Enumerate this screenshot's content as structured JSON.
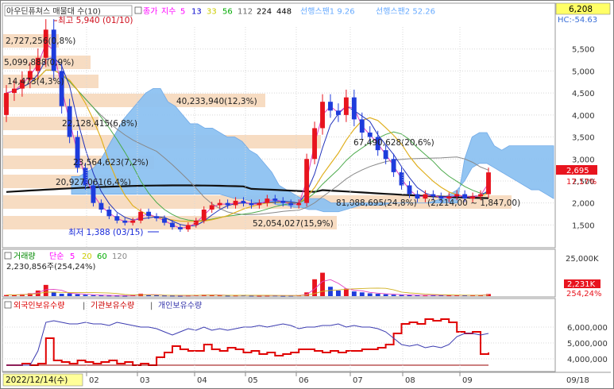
{
  "price_panel": {
    "title_stock": "아우딘퓨쳐스 매물대 수(10)",
    "legend": [
      {
        "text": "종가",
        "color": "#ff00ff"
      },
      {
        "text": "지수",
        "color": "#ff00ff"
      },
      {
        "text": "5",
        "color": "#ff00ff"
      },
      {
        "text": "13",
        "color": "#0000cc"
      },
      {
        "text": "33",
        "color": "#cccc00"
      },
      {
        "text": "56",
        "color": "#00aa00"
      },
      {
        "text": "112",
        "color": "#666666"
      },
      {
        "text": "224",
        "color": "#000000"
      },
      {
        "text": "448",
        "color": "#000000"
      },
      {
        "text": "선행스팬1 9.26",
        "color": "#66aaff"
      },
      {
        "text": "선행스팬2 52.26",
        "color": "#66aaff"
      }
    ],
    "hc_label": "HC:-54.63",
    "current_price_badge": "6,208",
    "y_ticks": [
      "5,500",
      "5,000",
      "4,500",
      "4,000",
      "3,500",
      "3,000",
      "2,500",
      "2,000",
      "1,500"
    ],
    "last_price": "2,695",
    "last_change": "17.17%",
    "high_annotation": "최고 5,940 (01/10)",
    "low_annotation": "최저 1,388 (03/15)",
    "volume_profile_labels": [
      "2,727,256(0,8%)",
      "5,099,888(0,9%)",
      "14,473(4,3%)",
      "40,233,940(12,3%)",
      "22,128,415(6,8%)",
      "67,490,628(20,6%)",
      "23,564,623(7,2%)",
      "20,927,061(6,4%)",
      "81,088,695(24,8%)",
      "52,054,027(15,9%)"
    ],
    "recent_label": "(2,214,00 ~ 1,847,00)"
  },
  "volume_panel": {
    "legend": [
      {
        "text": "거래량",
        "color": "#008800"
      },
      {
        "text": "단순",
        "color": "#ff00ff"
      },
      {
        "text": "5",
        "color": "#ff00ff"
      },
      {
        "text": "20",
        "color": "#cccc00"
      },
      {
        "text": "60",
        "color": "#00aa00"
      },
      {
        "text": "120",
        "color": "#888888"
      }
    ],
    "summary": "2,230,856주(254,24%)",
    "y_tick": "25,000K",
    "last_volume": "2,231K",
    "last_volume_pct": "254,24%"
  },
  "holdings_panel": {
    "legend": [
      {
        "text": "외국인보유수량",
        "color": "#dd0000"
      },
      {
        "text": "기관보유수량",
        "color": "#cc0000"
      },
      {
        "text": "개인보유수량",
        "color": "#3333aa"
      }
    ],
    "y_ticks": [
      "6,000,000",
      "5,000,000",
      "4,000,000"
    ]
  },
  "x_axis": {
    "start_date": "2022/12/14(수)",
    "months": [
      "02",
      "03",
      "04",
      "05",
      "06",
      "07",
      "08",
      "09"
    ],
    "end_date": "09/18"
  },
  "colors": {
    "up": "#e8141e",
    "down": "#1e3cdc",
    "cloud": "#7fbaf0",
    "profile": "#f7dcc2"
  },
  "chart_data": {
    "type": "candlestick",
    "price_series": [
      [
        4.0,
        4.5
      ],
      [
        4.5,
        4.6
      ],
      [
        4.6,
        4.8
      ],
      [
        4.8,
        5.0
      ],
      [
        5.0,
        5.3
      ],
      [
        5.3,
        5.94
      ],
      [
        5.94,
        5.0
      ],
      [
        5.0,
        4.2
      ],
      [
        4.2,
        3.5
      ],
      [
        3.5,
        2.8
      ],
      [
        2.8,
        2.4
      ],
      [
        2.4,
        2.0
      ],
      [
        2.0,
        1.85
      ],
      [
        1.85,
        1.7
      ],
      [
        1.7,
        1.6
      ],
      [
        1.6,
        1.55
      ],
      [
        1.55,
        1.6
      ],
      [
        1.6,
        1.8
      ],
      [
        1.8,
        1.7
      ],
      [
        1.7,
        1.65
      ],
      [
        1.65,
        1.55
      ],
      [
        1.55,
        1.45
      ],
      [
        1.45,
        1.4
      ],
      [
        1.4,
        1.5
      ],
      [
        1.5,
        1.6
      ],
      [
        1.6,
        1.85
      ],
      [
        1.85,
        1.95
      ],
      [
        1.95,
        2.0
      ],
      [
        2.0,
        1.95
      ],
      [
        1.95,
        2.05
      ],
      [
        2.05,
        2.0
      ],
      [
        2.0,
        1.95
      ],
      [
        1.95,
        2.0
      ],
      [
        2.0,
        2.1
      ],
      [
        2.1,
        2.05
      ],
      [
        2.05,
        2.0
      ],
      [
        2.0,
        1.95
      ],
      [
        1.95,
        2.0
      ],
      [
        2.0,
        3.0
      ],
      [
        3.0,
        3.7
      ],
      [
        3.7,
        4.3
      ],
      [
        4.3,
        4.1
      ],
      [
        4.1,
        4.0
      ],
      [
        4.0,
        4.4
      ],
      [
        4.4,
        3.9
      ],
      [
        3.9,
        3.6
      ],
      [
        3.6,
        3.5
      ],
      [
        3.5,
        3.2
      ],
      [
        3.2,
        3.0
      ],
      [
        3.0,
        2.7
      ],
      [
        2.7,
        2.4
      ],
      [
        2.4,
        2.2
      ],
      [
        2.2,
        2.1
      ],
      [
        2.1,
        2.2
      ],
      [
        2.2,
        2.15
      ],
      [
        2.15,
        2.1
      ],
      [
        2.1,
        2.15
      ],
      [
        2.15,
        2.2
      ],
      [
        2.2,
        2.1
      ],
      [
        2.1,
        2.15
      ],
      [
        2.15,
        2.2
      ],
      [
        2.2,
        2.695
      ]
    ],
    "volume_series": [
      1.2,
      1.5,
      2.0,
      3.0,
      6.0,
      12.0,
      4.0,
      2.5,
      3.0,
      2.0,
      1.5,
      1.0,
      0.8,
      0.7,
      0.6,
      0.5,
      1.0,
      2.5,
      1.2,
      0.9,
      0.7,
      0.6,
      0.5,
      0.7,
      0.9,
      1.5,
      1.2,
      0.8,
      0.6,
      0.7,
      0.8,
      0.6,
      0.5,
      0.6,
      0.7,
      0.5,
      0.6,
      0.8,
      4.0,
      18.0,
      25.0,
      10.0,
      6.0,
      8.0,
      5.0,
      4.0,
      3.0,
      2.5,
      2.0,
      1.5,
      1.2,
      1.0,
      0.9,
      0.8,
      1.0,
      0.9,
      0.8,
      1.1,
      0.9,
      1.0,
      1.2,
      2.231
    ],
    "ylim_price": [
      1.2,
      6.0
    ],
    "ylim_volume": [
      0,
      28
    ],
    "holdings": {
      "foreign": [
        3.6,
        3.6,
        3.7,
        3.6,
        3.7,
        5.3,
        3.9,
        3.8,
        3.7,
        3.9,
        3.8,
        3.7,
        3.8,
        3.9,
        3.7,
        3.8,
        3.6,
        3.7,
        3.6,
        4.1,
        4.4,
        4.8,
        4.6,
        4.5,
        4.5,
        4.9,
        4.6,
        4.5,
        4.7,
        4.6,
        4.4,
        4.5,
        4.3,
        4.4,
        4.2,
        4.3,
        4.4,
        4.6,
        4.6,
        4.5,
        4.4,
        4.5,
        4.4,
        4.5,
        4.5,
        4.6,
        4.6,
        4.7,
        4.9,
        5.6,
        6.2,
        6.3,
        6.2,
        6.5,
        6.4,
        6.5,
        6.3,
        5.7,
        5.6,
        5.7,
        4.3,
        4.4
      ],
      "institution": [
        3.6,
        3.6,
        3.6,
        3.6,
        3.6,
        3.6,
        3.6,
        3.6,
        3.6,
        3.6,
        3.6,
        3.6,
        3.6,
        3.6,
        3.6,
        3.6,
        3.6,
        3.6,
        3.6,
        3.6,
        3.6,
        3.6,
        3.6,
        3.6,
        3.6,
        3.6,
        3.6,
        3.6,
        3.6,
        3.6,
        3.6,
        3.6,
        3.6,
        3.6,
        3.6,
        3.6,
        3.6,
        3.6,
        3.6,
        3.6,
        3.6,
        3.6,
        3.6,
        3.6,
        3.6,
        3.6,
        3.6,
        3.6,
        3.6,
        3.6,
        3.6,
        3.6,
        3.6,
        3.6,
        3.6,
        3.6,
        3.6,
        3.6,
        3.6,
        3.6,
        3.6,
        3.6
      ],
      "individual": [
        3.6,
        3.6,
        3.6,
        3.6,
        4.5,
        6.3,
        6.4,
        6.3,
        6.2,
        6.2,
        6.3,
        6.2,
        6.2,
        6.1,
        6.3,
        6.2,
        6.1,
        6.0,
        6.0,
        5.9,
        5.7,
        5.5,
        5.7,
        5.9,
        5.8,
        6.0,
        5.8,
        5.9,
        5.8,
        5.9,
        6.0,
        6.0,
        6.1,
        6.0,
        6.1,
        6.2,
        6.1,
        5.9,
        6.0,
        6.0,
        6.1,
        6.1,
        6.2,
        6.0,
        6.1,
        6.0,
        6.0,
        5.9,
        5.7,
        5.3,
        4.9,
        4.8,
        4.9,
        4.7,
        4.8,
        4.7,
        4.9,
        5.4,
        5.6,
        5.6,
        5.5,
        5.6
      ],
      "ylim": [
        3.3,
        7.0
      ]
    }
  }
}
